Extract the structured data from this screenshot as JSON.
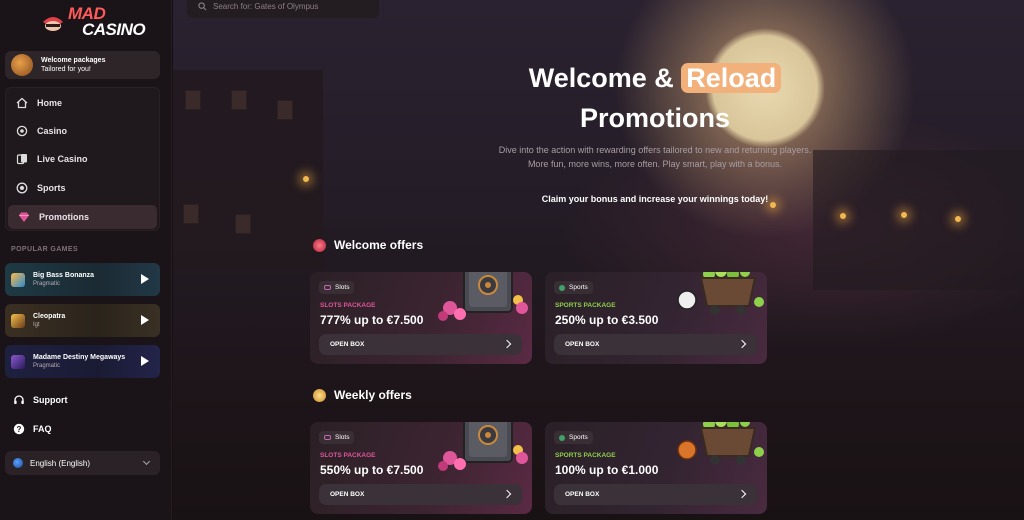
{
  "brand": {
    "line1": "MAD",
    "line2": "CASINO"
  },
  "welcome_card": {
    "title": "Welcome packages",
    "subtitle": "Tailored for you!"
  },
  "nav": [
    {
      "label": "Home",
      "icon": "home-icon"
    },
    {
      "label": "Casino",
      "icon": "casino-chip-icon"
    },
    {
      "label": "Live Casino",
      "icon": "cards-icon"
    },
    {
      "label": "Sports",
      "icon": "soccer-ball-icon"
    },
    {
      "label": "Promotions",
      "icon": "gem-icon",
      "active": true
    }
  ],
  "popular_games": {
    "label": "POPULAR GAMES",
    "items": [
      {
        "name": "Big Bass Bonanza",
        "provider": "Pragmatic"
      },
      {
        "name": "Cleopatra",
        "provider": "Igt"
      },
      {
        "name": "Madame Destiny Megaways",
        "provider": "Pragmatic"
      }
    ]
  },
  "links": {
    "support": "Support",
    "faq": "FAQ"
  },
  "language": "English (English)",
  "search": {
    "placeholder": "Search for: Gates of Olympus"
  },
  "hero": {
    "title_part1": "Welcome & ",
    "title_highlight": "Reload",
    "title_part2": "Promotions",
    "subtitle": "Dive into the action with rewarding offers tailored to new and returning players. More fun, more wins, more often. Play smart, play with a bonus.",
    "claim": "Claim your bonus and increase your winnings today!"
  },
  "sections": [
    {
      "title": "Welcome offers",
      "offers": [
        {
          "tag": "Slots",
          "package": "SLOTS PACKAGE",
          "amount": "777% up to €7.500",
          "button": "OPEN BOX"
        },
        {
          "tag": "Sports",
          "package": "SPORTS PACKAGE",
          "amount": "250% up to €3.500",
          "button": "OPEN BOX"
        }
      ]
    },
    {
      "title": "Weekly offers",
      "offers": [
        {
          "tag": "Slots",
          "package": "SLOTS PACKAGE",
          "amount": "550% up to €7.500",
          "button": "OPEN BOX"
        },
        {
          "tag": "Sports",
          "package": "SPORTS PACKAGE",
          "amount": "100% up to €1.000",
          "button": "OPEN BOX"
        }
      ]
    }
  ],
  "colors": {
    "accent": "#f2b07a",
    "slots_pink": "#e0569a",
    "sports_green": "#8fd04a",
    "sidebar_bg": "#1a1418"
  }
}
